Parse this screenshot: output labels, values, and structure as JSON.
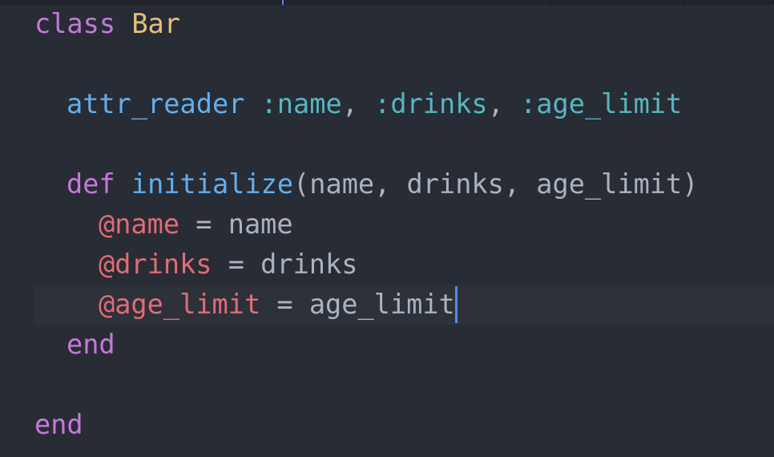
{
  "theme": {
    "background": "#282c34",
    "cursor_line": "#2c313a",
    "keyword": "#c678dd",
    "class_name": "#e5c07b",
    "function": "#61afef",
    "symbol": "#56b6c2",
    "instance_var": "#e06c75",
    "text": "#abb2bf",
    "cursor": "#528bff"
  },
  "code": {
    "l1": {
      "kw": "class",
      "sp": " ",
      "cls": "Bar"
    },
    "l3": {
      "fn": "attr_reader",
      "sp1": " ",
      "sym1": ":name",
      "c1": ", ",
      "sym2": ":drinks",
      "c2": ", ",
      "sym3": ":age_limit"
    },
    "l5": {
      "kw": "def",
      "sp": " ",
      "fn": "initialize",
      "args": "(name, drinks, age_limit)"
    },
    "l6": {
      "ivar": "@name",
      "rest": " = name"
    },
    "l7": {
      "ivar": "@drinks",
      "rest": " = drinks"
    },
    "l8": {
      "ivar": "@age_limit",
      "rest": " = age_limit"
    },
    "l9": {
      "kw": "end"
    },
    "l11": {
      "kw": "end"
    }
  }
}
